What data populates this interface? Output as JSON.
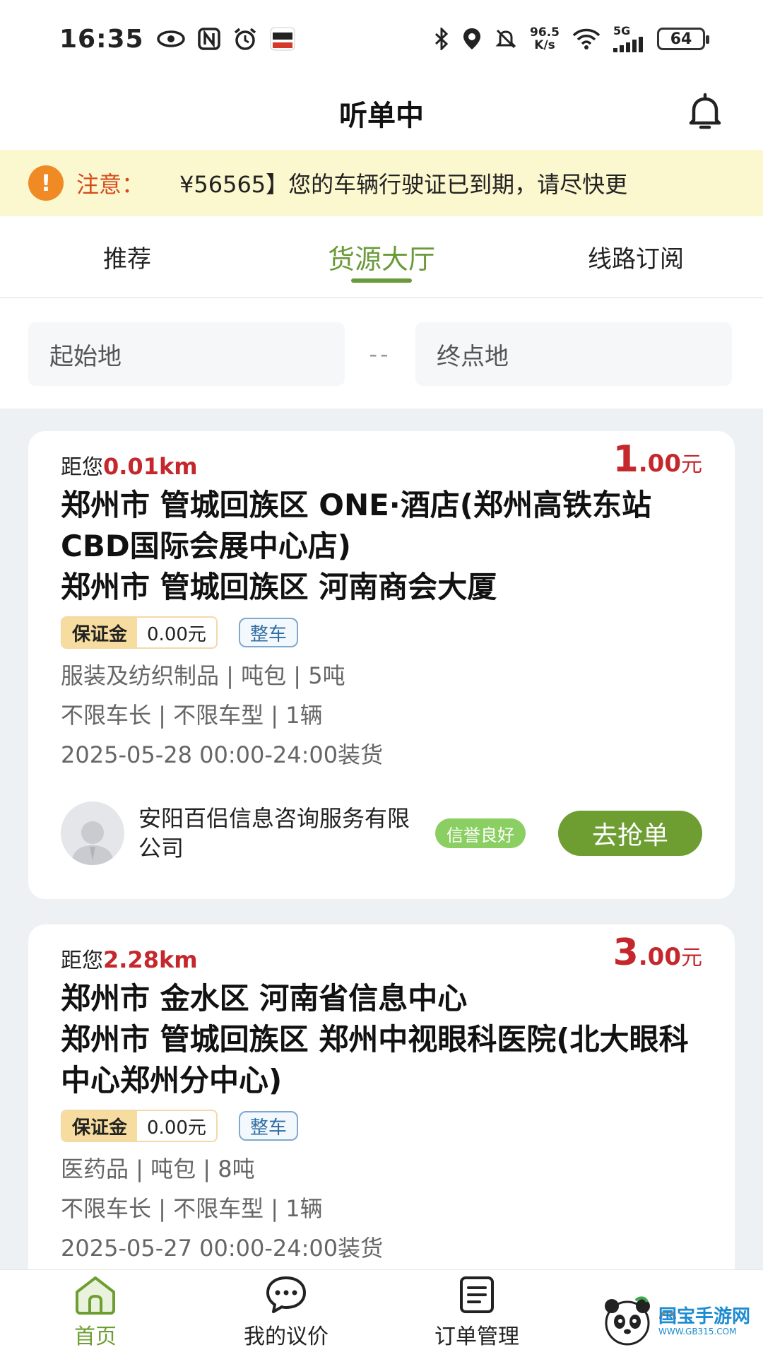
{
  "status_bar": {
    "time": "16:35",
    "speed_value": "96.5",
    "speed_unit": "K/s",
    "network": "5G",
    "battery": "64",
    "icons": [
      "eye-icon",
      "nfc-icon",
      "alarm-icon",
      "app-notification-icon",
      "bluetooth-icon",
      "location-icon",
      "mute-icon",
      "wifi-icon",
      "signal-icon"
    ]
  },
  "header": {
    "title": "听单中"
  },
  "notice": {
    "label": "注意：",
    "text": "¥56565】您的车辆行驶证已到期，请尽快更"
  },
  "tabs": [
    {
      "label": "推荐",
      "active": false
    },
    {
      "label": "货源大厅",
      "active": true
    },
    {
      "label": "线路订阅",
      "active": false
    }
  ],
  "search": {
    "origin_placeholder": "起始地",
    "separator": "--",
    "destination_placeholder": "终点地"
  },
  "orders": [
    {
      "distance_prefix": "距您",
      "distance": "0.01km",
      "price_int": "1",
      "price_dec": ".00",
      "price_unit": "元",
      "from_address": "郑州市 管城回族区 ONE·酒店(郑州高铁东站CBD国际会展中心店)",
      "to_address": "郑州市 管城回族区 河南商会大厦",
      "deposit_label": "保证金",
      "deposit_value": "0.00元",
      "vehicle_type": "整车",
      "cargo": "服装及纺织制品 | 吨包 | 5吨",
      "vehicle_req": "不限车长 | 不限车型 | 1辆",
      "loading_time": "2025-05-28 00:00-24:00装货",
      "company": "安阳百侣信息咨询服务有限公司",
      "credit": "信誉良好",
      "action": "去抢单"
    },
    {
      "distance_prefix": "距您",
      "distance": "2.28km",
      "price_int": "3",
      "price_dec": ".00",
      "price_unit": "元",
      "from_address": "郑州市 金水区 河南省信息中心",
      "to_address": "郑州市 管城回族区 郑州中视眼科医院(北大眼科中心郑州分中心)",
      "deposit_label": "保证金",
      "deposit_value": "0.00元",
      "vehicle_type": "整车",
      "cargo": "医药品 | 吨包 | 8吨",
      "vehicle_req": "不限车长 | 不限车型 | 1辆",
      "loading_time": "2025-05-27 00:00-24:00装货"
    }
  ],
  "bottom_nav": [
    {
      "label": "首页",
      "icon": "home-icon",
      "active": true
    },
    {
      "label": "我的议价",
      "icon": "chat-icon",
      "active": false
    },
    {
      "label": "订单管理",
      "icon": "order-icon",
      "active": false
    }
  ],
  "watermark": {
    "text": "国宝手游网",
    "url_text": "WWW.GB315.COM"
  },
  "colors": {
    "accent": "#6b9a3a",
    "price": "#c4282d",
    "notice_bg": "#fbf7cf",
    "notice_label": "#d64a1b"
  }
}
